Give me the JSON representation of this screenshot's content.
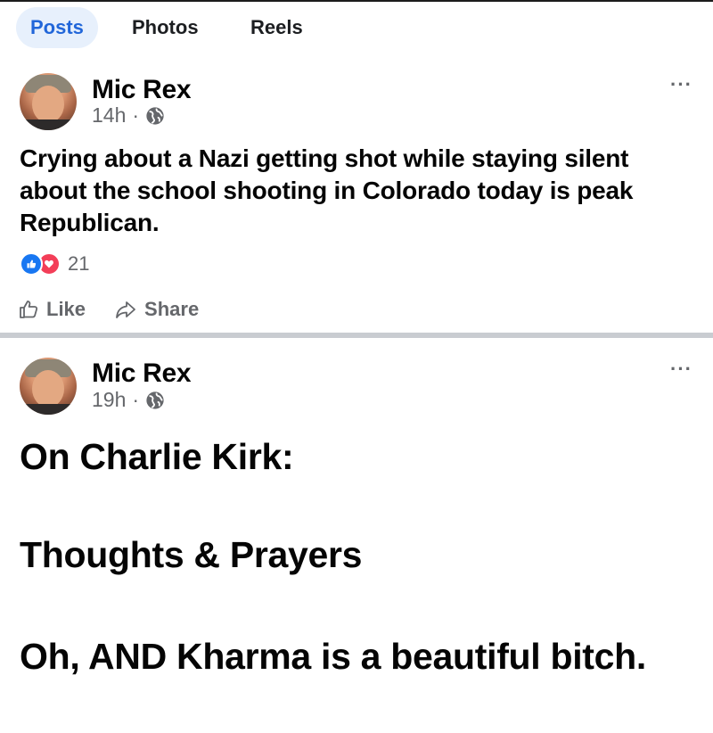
{
  "tabs": [
    {
      "label": "Posts",
      "active": true
    },
    {
      "label": "Photos",
      "active": false
    },
    {
      "label": "Reels",
      "active": false
    }
  ],
  "posts": [
    {
      "author": "Mic Rex",
      "time": "14h",
      "separator": "·",
      "privacy_icon": "globe-icon",
      "more": "···",
      "text": "Crying about a Nazi getting shot while staying silent about the school shooting in Colorado today is peak Republican.",
      "reactions": {
        "icons": [
          "like-icon",
          "love-icon"
        ],
        "count": "21"
      },
      "actions": {
        "like": "Like",
        "share": "Share"
      }
    },
    {
      "author": "Mic Rex",
      "time": "19h",
      "separator": "·",
      "privacy_icon": "globe-icon",
      "more": "···",
      "lines": [
        "On Charlie Kirk:",
        "Thoughts & Prayers",
        "Oh, AND Kharma is a beautiful bitch."
      ]
    }
  ],
  "colors": {
    "accent": "#2166d9",
    "tab_active_bg": "#e7f0fc",
    "secondary_text": "#65676b",
    "like_blue": "#1877f2",
    "love_red": "#f33e58",
    "divider": "#c9ccd1"
  }
}
